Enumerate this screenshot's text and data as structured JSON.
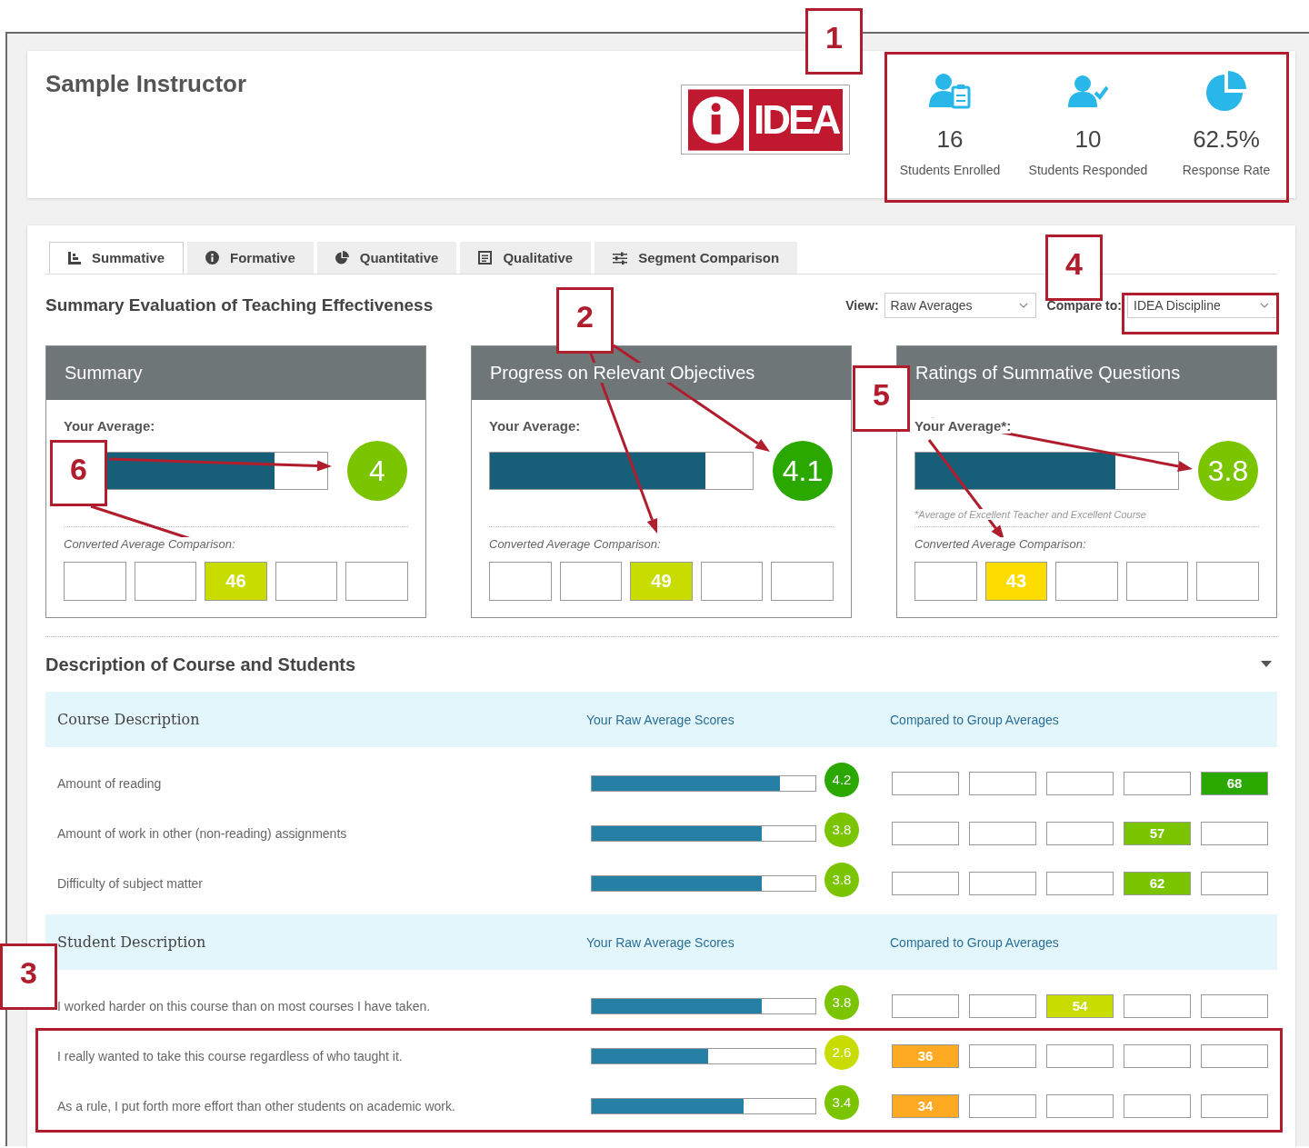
{
  "header": {
    "title": "Sample Instructor",
    "logo": {
      "text": "IDEA"
    },
    "stats": [
      {
        "kind": "enrolled",
        "value": "16",
        "label": "Students Enrolled"
      },
      {
        "kind": "responded",
        "value": "10",
        "label": "Students Responded"
      },
      {
        "kind": "rate",
        "value": "62.5%",
        "label": "Response Rate"
      }
    ]
  },
  "tabs": [
    {
      "label": "Summative",
      "selected": true
    },
    {
      "label": "Formative",
      "selected": false
    },
    {
      "label": "Quantitative",
      "selected": false
    },
    {
      "label": "Qualitative",
      "selected": false
    },
    {
      "label": "Segment Comparison",
      "selected": false
    }
  ],
  "summary": {
    "heading": "Summary Evaluation of Teaching Effectiveness",
    "view": {
      "label": "View:",
      "value": "Raw Averages"
    },
    "compare": {
      "label": "Compare to:",
      "value": "IDEA Discipline"
    },
    "panels": [
      {
        "title": "Summary",
        "average_label": "Your Average:",
        "level": 0.8,
        "score": {
          "text": "4",
          "color": "#7ac400"
        },
        "comparison_label": "Converted Average Comparison:",
        "comparison": [
          {
            "filled": false
          },
          {
            "filled": false
          },
          {
            "filled": true,
            "text": "46",
            "color": "#c8dc00"
          },
          {
            "filled": false
          },
          {
            "filled": false
          }
        ]
      },
      {
        "title": "Progress on Relevant Objectives",
        "average_label": "Your Average:",
        "level": 0.82,
        "score": {
          "text": "4.1",
          "color": "#2aa800"
        },
        "comparison_label": "Converted Average Comparison:",
        "comparison": [
          {
            "filled": false
          },
          {
            "filled": false
          },
          {
            "filled": true,
            "text": "49",
            "color": "#c8dc00"
          },
          {
            "filled": false
          },
          {
            "filled": false
          }
        ]
      },
      {
        "title": "Ratings of Summative Questions",
        "average_label": "Your Average*:",
        "level": 0.76,
        "score": {
          "text": "3.8",
          "color": "#7ac400"
        },
        "note": "*Average of Excellent Teacher and Excellent Course",
        "comparison_label": "Converted Average Comparison:",
        "comparison": [
          {
            "filled": false
          },
          {
            "filled": true,
            "text": "43",
            "color": "#ffdc00"
          },
          {
            "filled": false
          },
          {
            "filled": false
          },
          {
            "filled": false
          }
        ]
      }
    ]
  },
  "description": {
    "heading": "Description of Course and Students",
    "expanded": true,
    "sections": [
      {
        "title": "Course Description",
        "col_scores": "Your Raw Average Scores",
        "col_compare": "Compared to Group Averages",
        "rows": [
          {
            "label": "Amount of reading",
            "level": 0.84,
            "score": {
              "text": "4.2",
              "color": "#2aa800"
            },
            "comparison": [
              {
                "filled": false
              },
              {
                "filled": false
              },
              {
                "filled": false
              },
              {
                "filled": false
              },
              {
                "filled": true,
                "text": "68",
                "color": "#2aa800"
              }
            ]
          },
          {
            "label": "Amount of work in other (non-reading) assignments",
            "level": 0.76,
            "score": {
              "text": "3.8",
              "color": "#7ac400"
            },
            "comparison": [
              {
                "filled": false
              },
              {
                "filled": false
              },
              {
                "filled": false
              },
              {
                "filled": true,
                "text": "57",
                "color": "#7ac400"
              },
              {
                "filled": false
              }
            ]
          },
          {
            "label": "Difficulty of subject matter",
            "level": 0.76,
            "score": {
              "text": "3.8",
              "color": "#7ac400"
            },
            "comparison": [
              {
                "filled": false
              },
              {
                "filled": false
              },
              {
                "filled": false
              },
              {
                "filled": true,
                "text": "62",
                "color": "#7ac400"
              },
              {
                "filled": false
              }
            ]
          }
        ]
      },
      {
        "title": "Student Description",
        "col_scores": "Your Raw Average Scores",
        "col_compare": "Compared to Group Averages",
        "rows": [
          {
            "label": "I worked harder on this course than on most courses I have taken.",
            "level": 0.76,
            "score": {
              "text": "3.8",
              "color": "#7ac400"
            },
            "comparison": [
              {
                "filled": false
              },
              {
                "filled": false
              },
              {
                "filled": true,
                "text": "54",
                "color": "#c8dc00"
              },
              {
                "filled": false
              },
              {
                "filled": false
              }
            ]
          },
          {
            "label": "I really wanted to take this course regardless of who taught it.",
            "level": 0.52,
            "score": {
              "text": "2.6",
              "color": "#c8dc00"
            },
            "comparison": [
              {
                "filled": true,
                "text": "36",
                "color": "#ffaa22"
              },
              {
                "filled": false
              },
              {
                "filled": false
              },
              {
                "filled": false
              },
              {
                "filled": false
              }
            ]
          },
          {
            "label": "As a rule, I put forth more effort than other students on academic work.",
            "level": 0.68,
            "score": {
              "text": "3.4",
              "color": "#7ac400"
            },
            "comparison": [
              {
                "filled": true,
                "text": "34",
                "color": "#ffaa22"
              },
              {
                "filled": false
              },
              {
                "filled": false
              },
              {
                "filled": false
              },
              {
                "filled": false
              }
            ]
          }
        ]
      }
    ]
  },
  "annotations": [
    {
      "text": "1"
    },
    {
      "text": "2"
    },
    {
      "text": "3"
    },
    {
      "text": "4"
    },
    {
      "text": "5"
    },
    {
      "text": "6"
    }
  ]
}
